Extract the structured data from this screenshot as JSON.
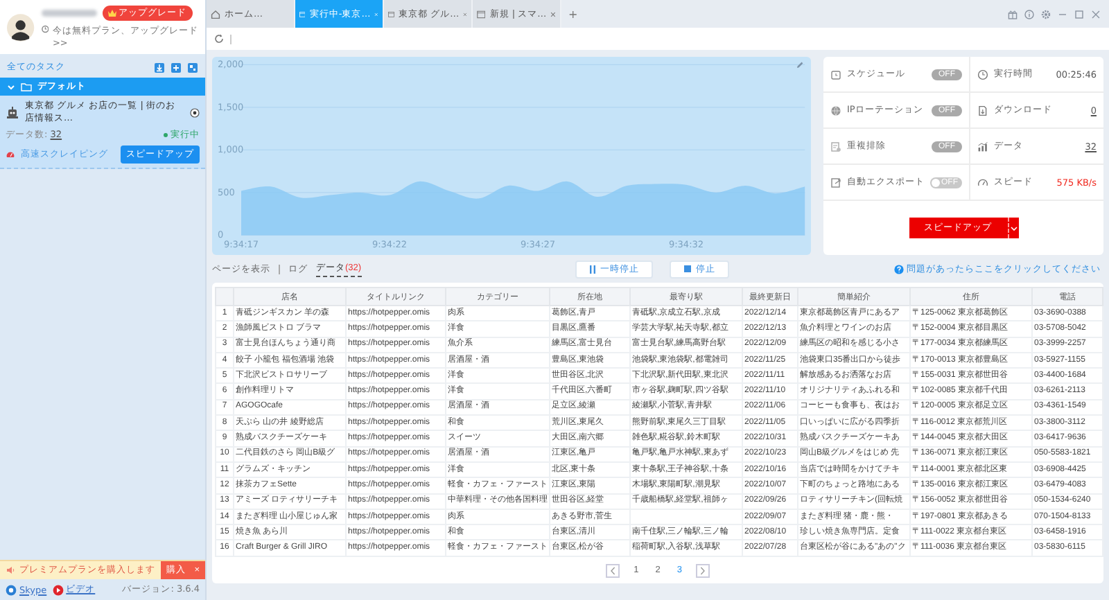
{
  "sidebar": {
    "account": {
      "upgrade_badge": "アップグレード",
      "plan_note": "今は無料プラン、アップグレード >>"
    },
    "all_tasks_label": "全てのタスク",
    "group": {
      "name": "デフォルト",
      "expanded": true
    },
    "tasks": [
      {
        "title": "東京都 グルメ お店の一覧 | 街のお店情報ス…",
        "data_count_label": "データ数:",
        "data_count": "32",
        "status": "実行中",
        "running": true,
        "mode_link": "高速スクレイピング",
        "speed_button": "スピードアップ"
      }
    ],
    "promo": {
      "text": "プレミアムプランを購入します",
      "button": "購入",
      "close": "×"
    },
    "footer": {
      "links": [
        {
          "kind": "skype",
          "label": "Skype"
        },
        {
          "kind": "video",
          "label": "ビデオ"
        }
      ],
      "version": "バージョン: 3.6.4"
    }
  },
  "tabs": [
    {
      "kind": "home",
      "label": "ホーム…",
      "selected": false
    },
    {
      "kind": "page",
      "label": "実行中-東京…",
      "selected": true
    },
    {
      "kind": "page",
      "label": "東京都 グル…",
      "selected": false
    },
    {
      "kind": "page",
      "label": "新規 | スマ…",
      "selected": false
    }
  ],
  "new_tab": "+",
  "chart": {
    "chart_data": {
      "type": "area",
      "categories": [
        "9:34:17",
        null,
        null,
        null,
        null,
        "9:34:22",
        null,
        null,
        null,
        null,
        "9:34:27",
        null,
        null,
        null,
        null,
        "9:34:32",
        null,
        null,
        null,
        null
      ],
      "series": [
        {
          "color": "#8ccaf5",
          "values": [
            520,
            570,
            440,
            470,
            500,
            470,
            630,
            520,
            430,
            580,
            520,
            630,
            450,
            580,
            600,
            590,
            500,
            580,
            490,
            570
          ]
        }
      ],
      "grid": true,
      "ylim": [
        0,
        2000
      ],
      "yticks": [
        {
          "value": 0,
          "label": "0"
        },
        {
          "value": 500,
          "label": "500"
        },
        {
          "value": 1000,
          "label": "1,000"
        },
        {
          "value": 1500,
          "label": "1,500"
        },
        {
          "value": 2000,
          "label": "2,000"
        }
      ]
    }
  },
  "panel": {
    "toggles": [
      {
        "label": "スケジュール",
        "on": false,
        "state_text": "OFF",
        "kind": "pill"
      },
      {
        "label": "IPローテーション",
        "on": false,
        "state_text": "OFF",
        "kind": "pill"
      },
      {
        "label": "重複排除",
        "on": false,
        "state_text": "OFF",
        "kind": "pill"
      },
      {
        "label": "自動エクスポート",
        "on": false,
        "state_text": "OFF",
        "kind": "switch"
      }
    ],
    "stats": [
      {
        "label": "実行時間",
        "value": "00:25:46",
        "kind": "plain"
      },
      {
        "label": "ダウンロード",
        "value": "0",
        "kind": "link"
      },
      {
        "label": "データ",
        "value": "32",
        "kind": "link"
      },
      {
        "label": "スピード",
        "value": "575 KB/s",
        "kind": "alert"
      }
    ],
    "speed_button": "スピードアップ"
  },
  "view_tabs": [
    {
      "label": "ページを表示",
      "selected": false
    },
    {
      "label": "ログ",
      "selected": false
    },
    {
      "label": "データ",
      "count": "(32)",
      "selected": true
    }
  ],
  "controls": [
    {
      "kind": "pause",
      "label": "一時停止"
    },
    {
      "kind": "stop",
      "label": "停止"
    }
  ],
  "help_link": "問題があったらここをクリックしてください",
  "table": {
    "columns": [
      "店名",
      "タイトルリンク",
      "カテゴリー",
      "所在地",
      "最寄り駅",
      "最終更新日",
      "簡単紹介",
      "住所",
      "電話"
    ],
    "rows": [
      {
        "index": "1",
        "cells": [
          "青砥ジンギスカン 羊の森",
          "https://hotpepper.omis",
          "肉系",
          "葛飾区,青戸",
          "青砥駅,京成立石駅,京成",
          "2022/12/14",
          "東京都葛飾区青戸にあるア",
          "〒125-0062 東京都葛飾区",
          "03-3690-0388"
        ]
      },
      {
        "index": "2",
        "cells": [
          "漁師風ビストロ ブラマ",
          "https://hotpepper.omis",
          "洋食",
          "目黒区,鷹番",
          "学芸大学駅,祐天寺駅,都立",
          "2022/12/13",
          "魚介料理とワインのお店",
          "〒152-0004 東京都目黒区",
          "03-5708-5042"
        ]
      },
      {
        "index": "3",
        "cells": [
          "富士見台ほんちょう通り商",
          "https://hotpepper.omis",
          "魚介系",
          "練馬区,富士見台",
          "富士見台駅,練馬高野台駅",
          "2022/12/09",
          "練馬区の昭和を感じる小さ",
          "〒177-0034 東京都練馬区",
          "03-3999-2257"
        ]
      },
      {
        "index": "4",
        "cells": [
          "餃子 小籠包 福包酒場 池袋",
          "https://hotpepper.omis",
          "居酒屋・酒",
          "豊島区,東池袋",
          "池袋駅,東池袋駅,都電雑司",
          "2022/11/25",
          "池袋東口35番出口から徒歩",
          "〒170-0013 東京都豊島区",
          "03-5927-1155"
        ]
      },
      {
        "index": "5",
        "cells": [
          "下北沢ビストロサリーブ",
          "https://hotpepper.omis",
          "洋食",
          "世田谷区,北沢",
          "下北沢駅,新代田駅,東北沢",
          "2022/11/11",
          "解放感あるお洒落なお店",
          "〒155-0031 東京都世田谷",
          "03-4400-1684"
        ]
      },
      {
        "index": "6",
        "cells": [
          "創作料理リトマ",
          "https://hotpepper.omis",
          "洋食",
          "千代田区,六番町",
          "市ヶ谷駅,麹町駅,四ツ谷駅",
          "2022/11/10",
          "オリジナリティあふれる和",
          "〒102-0085 東京都千代田",
          "03-6261-2113"
        ]
      },
      {
        "index": "7",
        "cells": [
          "AGOGOcafe",
          "https://hotpepper.omis",
          "居酒屋・酒",
          "足立区,綾瀬",
          "綾瀬駅,小菅駅,青井駅",
          "2022/11/06",
          "コーヒーも食事も、夜はお",
          "〒120-0005 東京都足立区",
          "03-4361-1549"
        ]
      },
      {
        "index": "8",
        "cells": [
          "天ぷら 山の井 綾野総店",
          "https://hotpepper.omis",
          "和食",
          "荒川区,東尾久",
          "熊野前駅,東尾久三丁目駅",
          "2022/11/05",
          "口いっぱいに広がる四季折",
          "〒116-0012 東京都荒川区",
          "03-3800-3112"
        ]
      },
      {
        "index": "9",
        "cells": [
          "熟成バスクチーズケーキ",
          "https://hotpepper.omis",
          "スイーツ",
          "大田区,南六郷",
          "雑色駅,糀谷駅,鈴木町駅",
          "2022/10/31",
          "熟成バスクチーズケーキあ",
          "〒144-0045 東京都大田区",
          "03-6417-9636"
        ]
      },
      {
        "index": "10",
        "cells": [
          "二代目鉄のさら 岡山B級グ",
          "https://hotpepper.omis",
          "居酒屋・酒",
          "江東区,亀戸",
          "亀戸駅,亀戸水神駅,東あず",
          "2022/10/23",
          "岡山B級グルメをはじめ 先",
          "〒136-0071 東京都江東区",
          "050-5583-1821"
        ]
      },
      {
        "index": "11",
        "cells": [
          "グラムズ・キッチン",
          "https://hotpepper.omis",
          "洋食",
          "北区,東十条",
          "東十条駅,王子神谷駅,十条",
          "2022/10/16",
          "当店では時間をかけてチキ",
          "〒114-0001 東京都北区東",
          "03-6908-4425"
        ]
      },
      {
        "index": "12",
        "cells": [
          "抹茶カフェSette",
          "https://hotpepper.omis",
          "軽食・カフェ・ファースト",
          "江東区,東陽",
          "木場駅,東陽町駅,潮見駅",
          "2022/10/07",
          "下町のちょっと路地にある",
          "〒135-0016 東京都江東区",
          "03-6479-4083"
        ]
      },
      {
        "index": "13",
        "cells": [
          "アミーズ ロティサリーチキ",
          "https://hotpepper.omis",
          "中華料理・その他各国料理",
          "世田谷区,経堂",
          "千歳船橋駅,経堂駅,祖師ヶ",
          "2022/09/26",
          "ロティサリーチキン(回転焼",
          "〒156-0052 東京都世田谷",
          "050-1534-6240"
        ]
      },
      {
        "index": "14",
        "cells": [
          "またぎ料理 山小屋じゅん家",
          "https://hotpepper.omis",
          "肉系",
          "あきる野市,菅生",
          "",
          "2022/09/07",
          "またぎ料理 猪・鹿・熊・",
          "〒197-0801 東京都あきる",
          "070-1504-8133"
        ]
      },
      {
        "index": "15",
        "cells": [
          "焼き魚 あら川",
          "https://hotpepper.omis",
          "和食",
          "台東区,清川",
          "南千住駅,三ノ輪駅,三ノ輪",
          "2022/08/10",
          "珍しい焼き魚専門店。定食",
          "〒111-0022 東京都台東区",
          "03-6458-1916"
        ]
      },
      {
        "index": "16",
        "cells": [
          "Craft Burger & Grill JIRO",
          "https://hotpepper.omis",
          "軽食・カフェ・ファースト",
          "台東区,松が谷",
          "稲荷町駅,入谷駅,浅草駅",
          "2022/07/28",
          "台東区松が谷にある\"あの\"ク",
          "〒111-0036 東京都台東区",
          "03-5830-6115"
        ]
      }
    ]
  },
  "pagination": {
    "pages": [
      {
        "label": "1",
        "selected": false
      },
      {
        "label": "2",
        "selected": false
      },
      {
        "label": "3",
        "selected": true
      }
    ]
  }
}
